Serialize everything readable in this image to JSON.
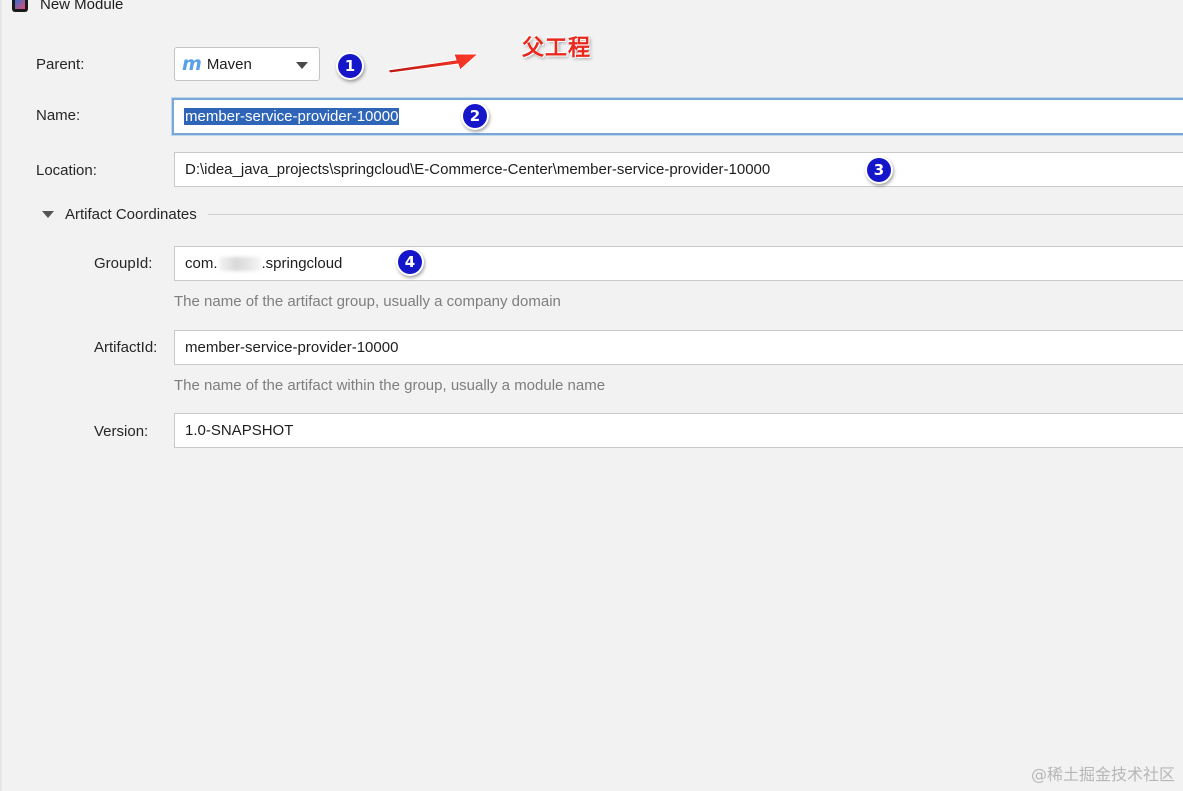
{
  "window": {
    "title": "New Module"
  },
  "form": {
    "parent": {
      "label": "Parent:",
      "value": "Maven"
    },
    "name": {
      "label": "Name:",
      "value": "member-service-provider-10000"
    },
    "location": {
      "label": "Location:",
      "value": "D:\\idea_java_projects\\springcloud\\E-Commerce-Center\\member-service-provider-10000"
    },
    "artifact_section": {
      "title": "Artifact Coordinates"
    },
    "group_id": {
      "label": "GroupId:",
      "value_prefix": "com.",
      "value_suffix": ".springcloud",
      "hint": "The name of the artifact group, usually a company domain"
    },
    "artifact_id": {
      "label": "ArtifactId:",
      "value": "member-service-provider-10000",
      "hint": "The name of the artifact within the group, usually a module name"
    },
    "version": {
      "label": "Version:",
      "value": "1.0-SNAPSHOT"
    }
  },
  "annotations": {
    "badges": [
      "1",
      "2",
      "3",
      "4"
    ],
    "parent_note": "父工程",
    "note_color": "#e8281d",
    "badge_color": "#1515c9"
  },
  "watermark": "@稀土掘金技术社区",
  "colors": {
    "selection": "#2e65b8",
    "focus_border": "#7aa8d6",
    "maven_icon": "#5aa0e6"
  }
}
